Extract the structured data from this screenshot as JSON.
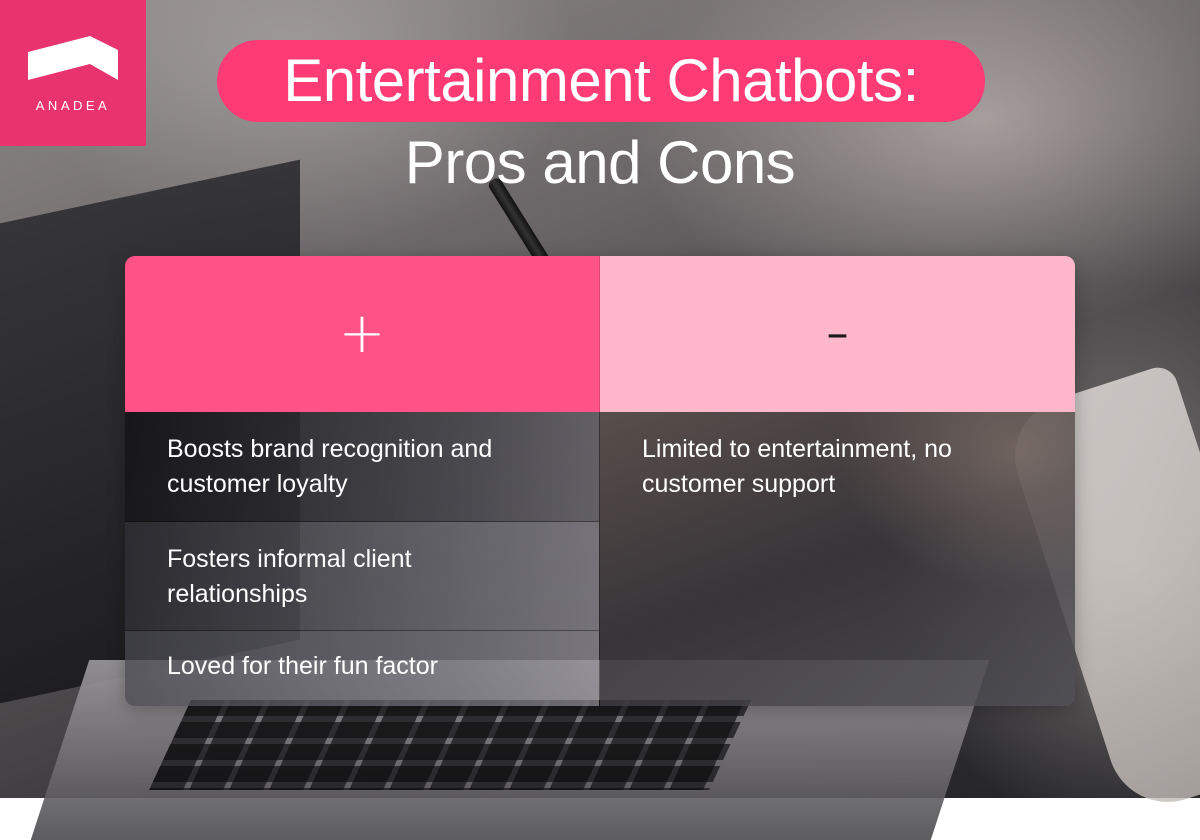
{
  "brand": {
    "name": "ANADEA",
    "color": "#e8336e"
  },
  "title": {
    "line1": "Entertainment Chatbots:",
    "line2": "Pros and Cons",
    "accent": "#ff3b76"
  },
  "table": {
    "pros_symbol": "+",
    "cons_symbol": "–",
    "pros_header_color": "#ff5287",
    "cons_header_color": "#ffb7cc",
    "pros": [
      "Boosts brand recognition and customer loyalty",
      "Fosters informal client relationships",
      "Loved for their fun factor"
    ],
    "cons": [
      "Limited to entertainment, no customer support"
    ]
  }
}
